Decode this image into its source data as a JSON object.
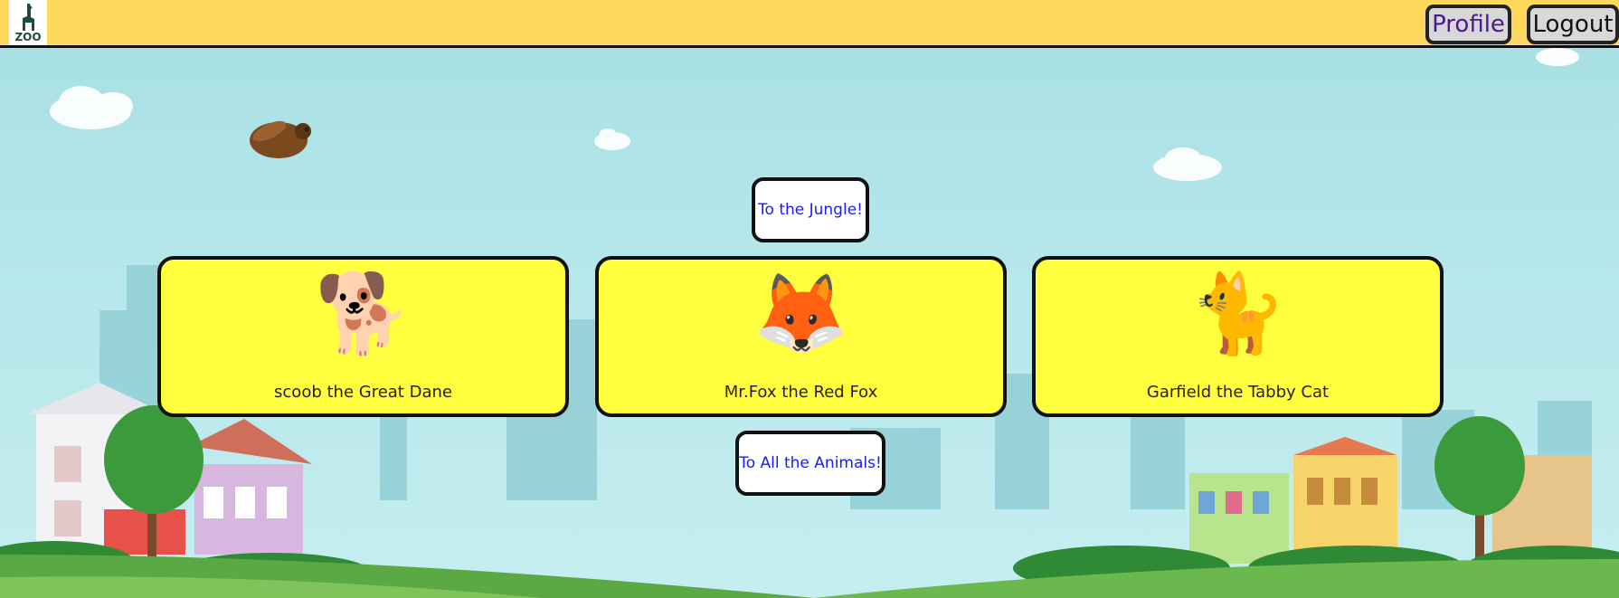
{
  "header": {
    "logo_text": "ZOO",
    "profile_label": "Profile",
    "logout_label": "Logout"
  },
  "main": {
    "top_link": "To the Jungle!",
    "bottom_link": "To All the Animals!",
    "cards": [
      {
        "emoji": "🐕",
        "name": "scoob the Great Dane"
      },
      {
        "emoji": "🦊",
        "name": "Mr.Fox the Red Fox"
      },
      {
        "emoji": "🐈",
        "name": "Garfield the Tabby Cat"
      }
    ]
  },
  "colors": {
    "header_bg": "#ffd95c",
    "card_bg": "#ffff3f",
    "link_text": "#1a1aff",
    "profile_text": "#4b1a8c",
    "sky": "#a6dfe3"
  },
  "icons": [
    "zoo-logo-icon",
    "bird-icon"
  ]
}
